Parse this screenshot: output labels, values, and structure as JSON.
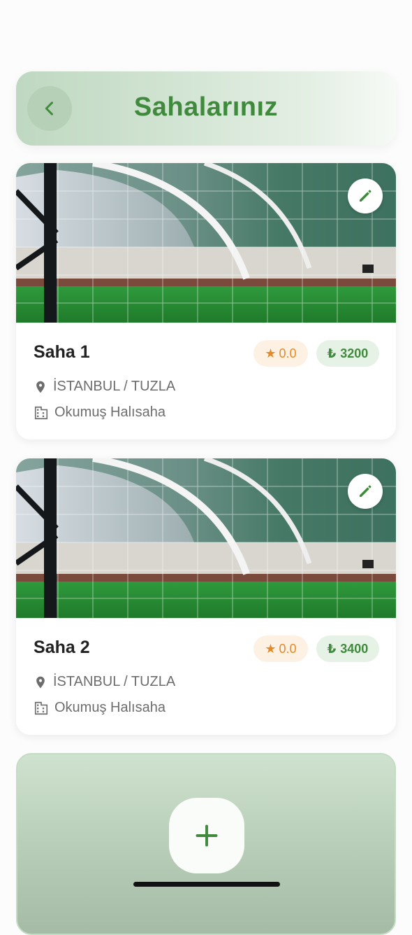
{
  "header": {
    "title": "Sahalarınız",
    "back_icon": "chevron-left-icon"
  },
  "fields": [
    {
      "name": "Saha 1",
      "rating": "0.0",
      "price": "3200",
      "currency_symbol": "₺",
      "location": "İSTANBUL / TUZLA",
      "facility": "Okumuş Halısaha"
    },
    {
      "name": "Saha 2",
      "rating": "0.0",
      "price": "3400",
      "currency_symbol": "₺",
      "location": "İSTANBUL / TUZLA",
      "facility": "Okumuş Halısaha"
    }
  ],
  "add_button": {
    "icon": "plus-icon"
  },
  "colors": {
    "brand_green": "#3f8a3d",
    "rating_orange": "#e48a28",
    "muted_text": "#6d6d6d"
  }
}
